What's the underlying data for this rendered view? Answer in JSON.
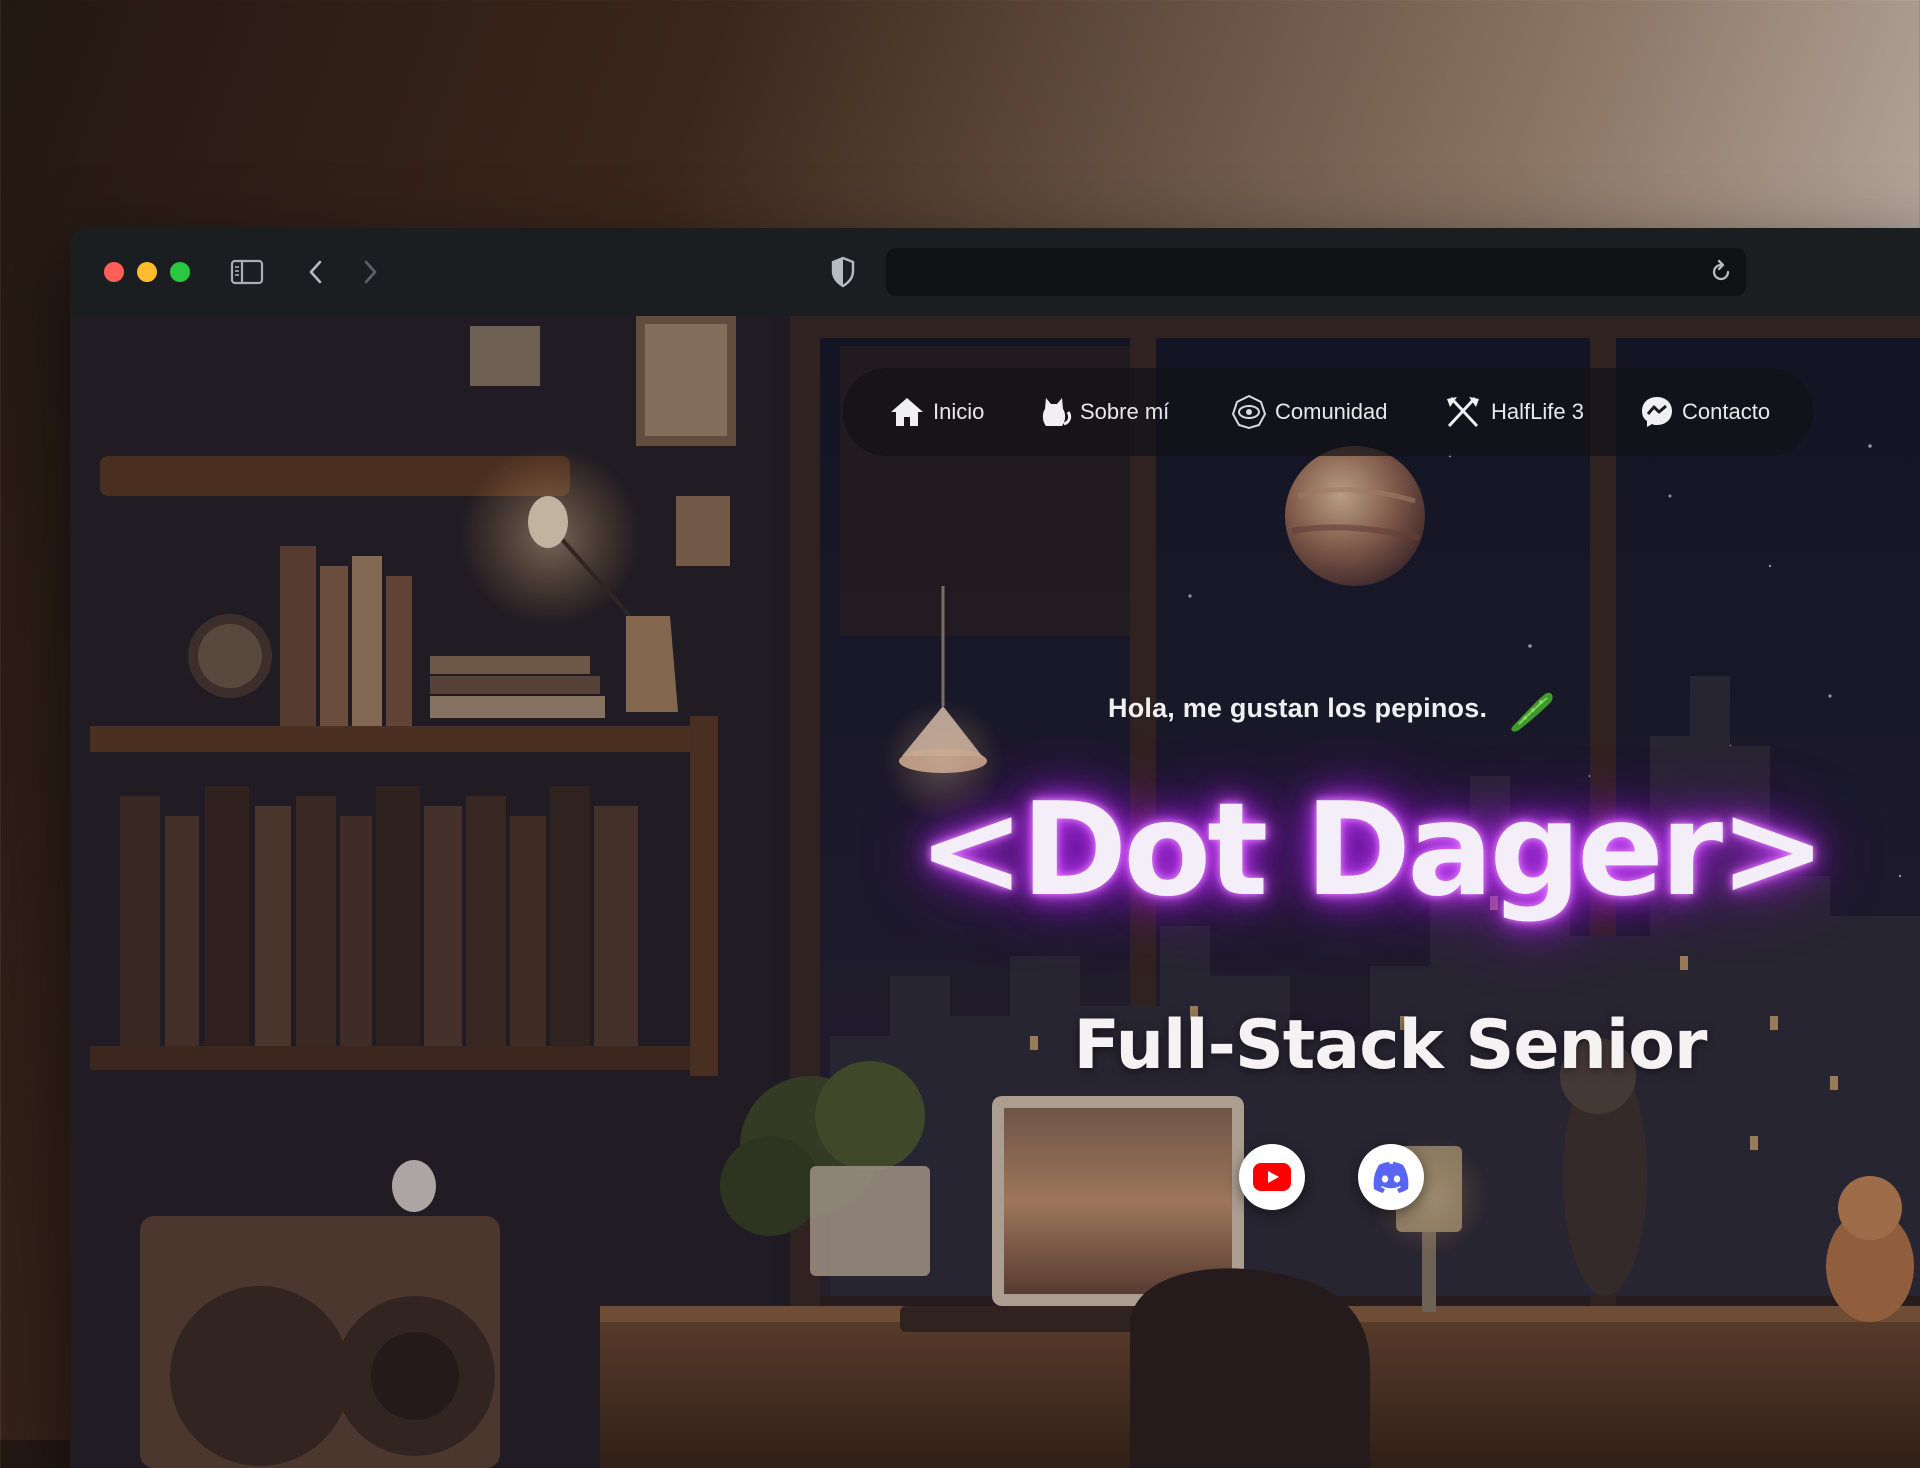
{
  "browser": {
    "icons": [
      "sidebar-toggle-icon",
      "back-icon",
      "forward-icon",
      "privacy-shield-icon",
      "reload-icon"
    ],
    "address_value": ""
  },
  "nav": {
    "items": [
      {
        "label": "Inicio",
        "icon": "home-icon"
      },
      {
        "label": "Sobre mí",
        "icon": "cat-icon"
      },
      {
        "label": "Comunidad",
        "icon": "community-icon"
      },
      {
        "label": "HalfLife 3",
        "icon": "crossed-axes-icon"
      },
      {
        "label": "Contacto",
        "icon": "messenger-icon"
      }
    ]
  },
  "hero": {
    "greeting": "Hola, me gustan los pepinos.",
    "greeting_icon": "cucumber-icon",
    "name": "<Dot Dager>",
    "role": "Full-Stack Senior",
    "accent": "#c23cf0"
  },
  "social": [
    {
      "icon": "youtube-icon",
      "color": "#ff0000"
    },
    {
      "icon": "discord-icon",
      "color": "#5865f2"
    }
  ]
}
